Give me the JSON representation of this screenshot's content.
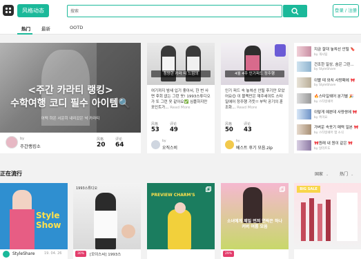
{
  "header": {
    "feed_tab": "风格动态",
    "search_placeholder": "搜索",
    "login": "登录 / 注册"
  },
  "subnav": {
    "tabs": [
      "热门",
      "最新",
      "OOTD"
    ]
  },
  "hero": {
    "title_line1": "<주간 카라티 랭킹>",
    "title_line2": "수학여행 코디 필수 아이템🔍",
    "caption": "어떡 하온 서운히 내리갔은 넉 카라티",
    "by": "by",
    "author": "주간랭킹소",
    "stat1_label": "风格",
    "stat1_value": "20",
    "stat2_label": "评论",
    "stat2_value": "64"
  },
  "cards": [
    {
      "banner": "청량한 카라 티 느낌의",
      "text": "여기까지 밤새 입기 좋아서, 한 번 사면 후회 없는 그런 옷! 1993스튜디오가 또 그런 옷 같아요✅ 심플하지만 포인트가...",
      "more": "Read More",
      "stat1_label": "风格",
      "stat1_value": "53",
      "stat2_label": "评论",
      "stat2_value": "49",
      "by": "by",
      "author": "오직스비"
    },
    {
      "banner": "4월 4주 인기피드 정주행",
      "text": "인기 피드 속 놓쳐선 안될 후기만 모았어요😊 이 블랙만은 재주세이트 스타일에어 정주행 가듯!! 부탁 공기의 훈조화...",
      "more": "Read More",
      "stat1_label": "风格",
      "stat1_value": "50",
      "stat2_label": "评论",
      "stat2_value": "43",
      "by": "by",
      "author": "베스트 후기 모음.zip"
    }
  ],
  "side_list": [
    {
      "title": "지금 잘대 놓쳐선 안될 🔖",
      "by": "by 개시팀"
    },
    {
      "title": "건조한 일상, 숨은 그린...",
      "by": "by StyleShare"
    },
    {
      "title": "이빨 테 와치 사랑패에 🎀",
      "by": "by StyleShare"
    },
    {
      "title": "🔥스타일쉐어 분기별 🎉",
      "by": "by 스타일쉐어"
    },
    {
      "title": "이렇게 예쁜데 사량쌍에 🎀",
      "by": "by 흑미요"
    },
    {
      "title": "가벼운 속옷기 매력 일본 🎀",
      "by": "by 스타일쉐어 앱 소식"
    },
    {
      "title": "🎀원래 내 원이 같은 🎀",
      "by": "by 알리트도"
    }
  ],
  "trending": {
    "title": "正在流行",
    "filter1": "国家",
    "filter2": "热门",
    "cards": [
      {
        "label": "StyleShare",
        "date": "19. 04. 26",
        "image_text": "Style Show"
      },
      {
        "badge": "30%",
        "label": "[모이스씨] 1993스",
        "image_text": "1993스튜디오"
      },
      {
        "badge": "",
        "label": "",
        "image_text": "PREVIEW CHARM'S"
      },
      {
        "badge": "29%",
        "label": "",
        "image_text": "소녀에게 제일 먼저 연락은 하나 커버 여름 모음"
      },
      {
        "badge": "",
        "label": "",
        "image_text": "BIG SALE"
      }
    ]
  },
  "colors": {
    "accent": "#1bb99a",
    "badge": "#e33d6c"
  }
}
